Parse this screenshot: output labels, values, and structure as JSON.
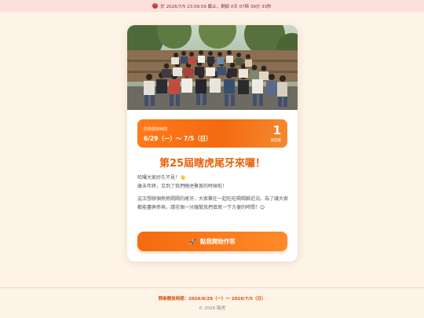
{
  "banner": {
    "icon": "clock-icon",
    "text": "於 2026/7/5 23:59:59 截止，剩餘 0天 07時 39分 33秒"
  },
  "card": {
    "deadline": {
      "label": "問卷開放時間",
      "dates": "6/29（一）～ 7/5（日）",
      "count": "1",
      "count_label": "筆回覆"
    },
    "title": "第25屆瞎虎尾牙來囉！",
    "para1_line1": "哈囉大家好久不見！👋",
    "para1_line2": "歲末年終，又到了我們瞎虎聚首的時候啦！",
    "para2": "這次想辦個熱熱鬧鬧的尾牙，大家聚在一起吃吃喝喝聊近況。為了讓大家都能盡興參與，請花個一分鐘幫我們填寫一下方便的時間！😊",
    "cta_label": "點我開始作答",
    "cta_icon": "rocket-icon"
  },
  "footer": {
    "range": "問卷開放時間：2026/6/29（一）～ 2026/7/5（日）",
    "copyright": "© 2026 瞎虎"
  },
  "colors": {
    "accent": "#f36b10",
    "title": "#e8620d",
    "background": "#fdf3e7",
    "banner": "#fbe0de"
  }
}
